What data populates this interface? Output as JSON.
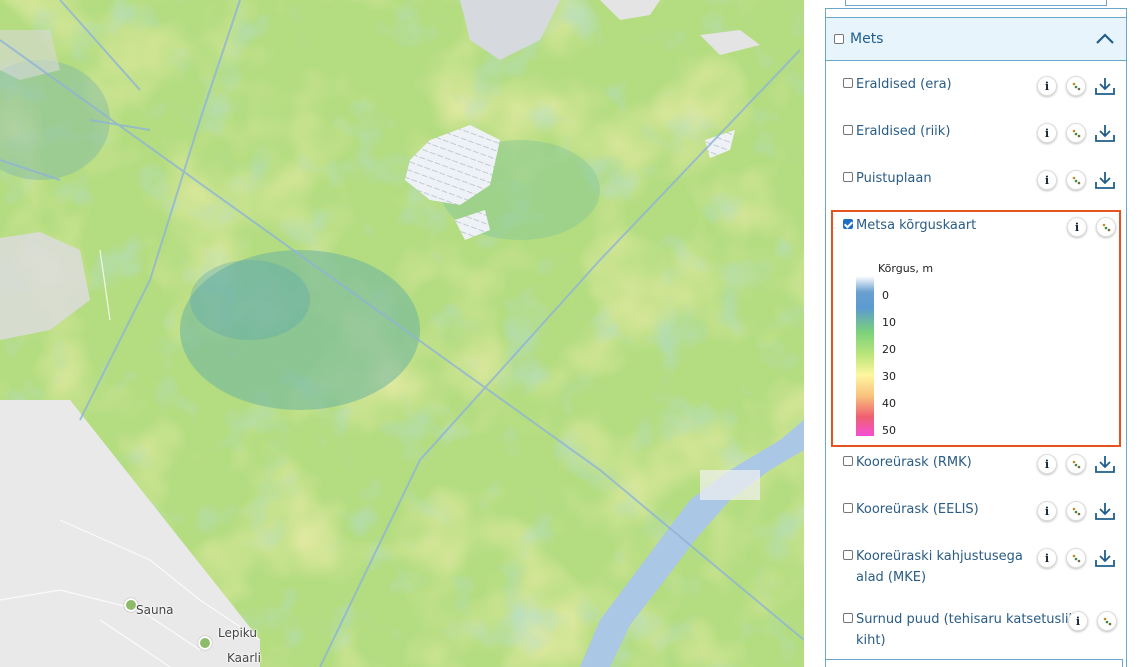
{
  "map": {
    "labels": [
      "Sauna",
      "Lepiku",
      "Kaarli"
    ]
  },
  "panel": {
    "group": {
      "title": "Mets",
      "checked": false
    },
    "layers": [
      {
        "label": "Eraldised (era)",
        "checked": false,
        "download": true
      },
      {
        "label": "Eraldised (riik)",
        "checked": false,
        "download": true
      },
      {
        "label": "Puistuplaan",
        "checked": false,
        "download": true
      },
      {
        "label": "Metsa kõrguskaart",
        "checked": true,
        "download": false
      },
      {
        "label": "Kooreürask (RMK)",
        "checked": false,
        "download": true
      },
      {
        "label": "Kooreürask (EELIS)",
        "checked": false,
        "download": true
      },
      {
        "label": "Kooreüraski kahjustusega alad (MKE)",
        "label_line1": "Kooreüraski kahjustusega",
        "label_line2": "alad (MKE)",
        "checked": false,
        "download": true
      },
      {
        "label": "Surnud puud (tehisaru katsetuslik kiht)",
        "label_line1": "Surnud puud (tehisaru katsetuslik",
        "label_line2": "kiht)",
        "checked": false,
        "download": false
      }
    ],
    "legend": {
      "title": "Kõrgus, m",
      "ticks": [
        "0",
        "10",
        "20",
        "30",
        "40",
        "50"
      ]
    },
    "icons": {
      "info": "info-icon",
      "transparency": "transparency-icon",
      "download": "download-icon",
      "collapse": "chevron-up-icon"
    },
    "colors": {
      "accent": "#1f5e8c",
      "highlight_border": "#e4541e",
      "panel_border": "#6aa7c9"
    }
  }
}
